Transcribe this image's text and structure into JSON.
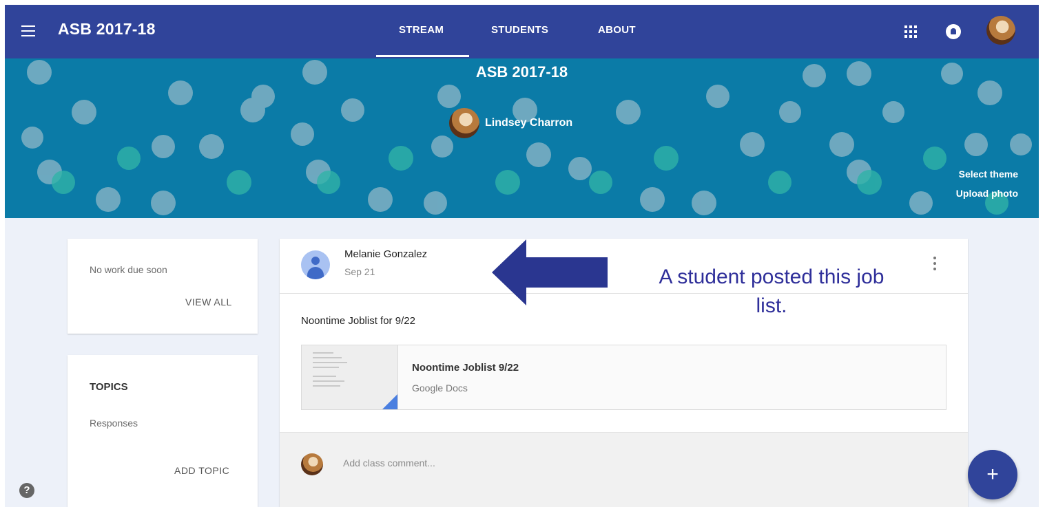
{
  "app": {
    "title": "ASB 2017-18"
  },
  "tabs": [
    {
      "label": "STREAM",
      "active": true
    },
    {
      "label": "STUDENTS",
      "active": false
    },
    {
      "label": "ABOUT",
      "active": false
    }
  ],
  "icons": {
    "menu": "hamburger-menu-icon",
    "apps": "apps-grid-icon",
    "notifications": "notifications-icon",
    "help": "help-icon",
    "fab": "add-icon"
  },
  "banner": {
    "class_name": "ASB 2017-18",
    "teacher_name": "Lindsey Charron",
    "select_theme": "Select theme",
    "upload_photo": "Upload photo",
    "background_color": "#0b7ba7"
  },
  "upcoming": {
    "text": "No work due soon",
    "view_all": "VIEW ALL"
  },
  "topics": {
    "heading": "TOPICS",
    "items": [
      "Responses"
    ],
    "add_topic": "ADD TOPIC"
  },
  "post": {
    "author": "Melanie Gonzalez",
    "date": "Sep 21",
    "text": "Noontime Joblist for 9/22",
    "attachment": {
      "title": "Noontime Joblist 9/22",
      "type": "Google Docs"
    },
    "comment_placeholder": "Add class comment..."
  },
  "annotation": {
    "text": "A student posted this job list.",
    "color": "#2f2f9a"
  },
  "colors": {
    "app_bar": "#30449a",
    "page_background": "#edf1f9",
    "fab": "#30449a"
  },
  "fab_label": "+",
  "help_label": "?"
}
